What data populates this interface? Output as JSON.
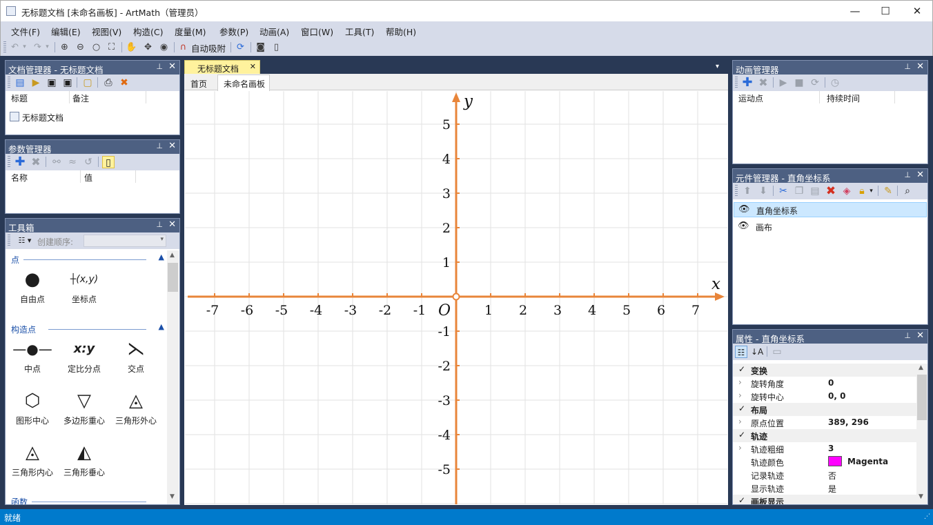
{
  "window": {
    "title": "无标题文档 [未命名画板] - ArtMath（管理员）",
    "minimize": "—",
    "maximize": "☐",
    "close": "✕"
  },
  "menu": [
    "文件(F)",
    "编辑(E)",
    "视图(V)",
    "构造(C)",
    "度量(M)",
    "参数(P)",
    "动画(A)",
    "窗口(W)",
    "工具(T)",
    "帮助(H)"
  ],
  "toolbar": {
    "auto_snap": "自动吸附"
  },
  "doc_manager": {
    "title": "文档管理器 - 无标题文档",
    "columns": [
      "标题",
      "备注"
    ],
    "items": [
      "无标题文档"
    ]
  },
  "param_manager": {
    "title": "参数管理器",
    "columns": [
      "名称",
      "值"
    ]
  },
  "toolbox": {
    "title": "工具箱",
    "create_order_label": "创建顺序:",
    "sections": [
      {
        "name": "点",
        "tools": [
          "自由点",
          "坐标点"
        ]
      },
      {
        "name": "构造点",
        "tools": [
          "中点",
          "定比分点",
          "交点",
          "图形中心",
          "多边形重心",
          "三角形外心",
          "三角形内心",
          "三角形垂心"
        ]
      },
      {
        "name": "函数"
      }
    ]
  },
  "canvas": {
    "doc_tab": "无标题文档",
    "tabs": [
      "首页",
      "未命名画板"
    ],
    "x_label": "x",
    "y_label": "y",
    "origin_label": "O",
    "x_ticks": [
      "-7",
      "-6",
      "-5",
      "-4",
      "-3",
      "-2",
      "-1",
      "1",
      "2",
      "3",
      "4",
      "5",
      "6",
      "7"
    ],
    "y_ticks": [
      "5",
      "4",
      "3",
      "2",
      "1",
      "-1",
      "-2",
      "-3",
      "-4",
      "-5"
    ],
    "axis_color": "#e8853a"
  },
  "anim_manager": {
    "title": "动画管理器",
    "columns": [
      "运动点",
      "持续时间"
    ]
  },
  "elem_manager": {
    "title": "元件管理器 - 直角坐标系",
    "items": [
      "直角坐标系",
      "画布"
    ]
  },
  "properties": {
    "title": "属性 - 直角坐标系",
    "categories": [
      {
        "name": "变换",
        "rows": [
          {
            "key": "旋转角度",
            "value": "0"
          },
          {
            "key": "旋转中心",
            "value": "0, 0"
          }
        ]
      },
      {
        "name": "布局",
        "rows": [
          {
            "key": "原点位置",
            "value": "389, 296"
          }
        ]
      },
      {
        "name": "轨迹",
        "rows": [
          {
            "key": "轨迹粗细",
            "value": "3"
          },
          {
            "key": "轨迹颜色",
            "value": "Magenta"
          },
          {
            "key": "记录轨迹",
            "value": "否"
          },
          {
            "key": "显示轨迹",
            "value": "是"
          }
        ]
      },
      {
        "name": "画板显示"
      }
    ],
    "swatch_color": "#ff00ff"
  },
  "status": {
    "text": "就绪"
  }
}
